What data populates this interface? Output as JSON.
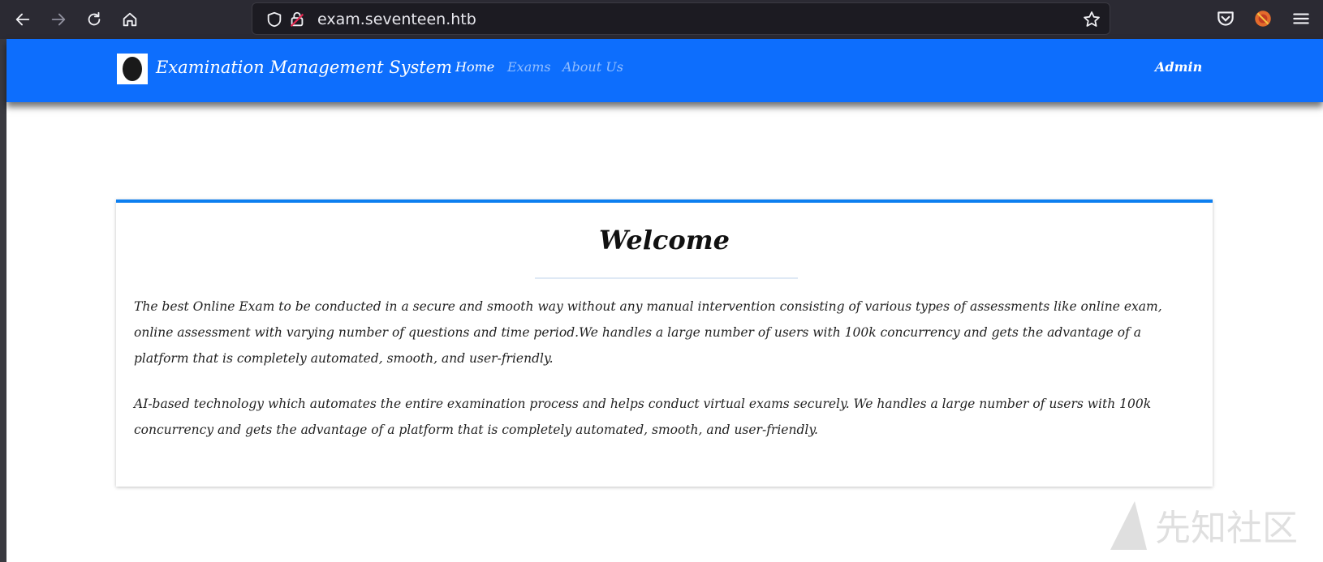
{
  "browser": {
    "url": "exam.seventeen.htb"
  },
  "site": {
    "brand": "Examination Management System",
    "nav": {
      "home": "Home",
      "exams": "Exams",
      "about": "About Us",
      "user": "Admin"
    }
  },
  "card": {
    "title": "Welcome",
    "paragraphs": [
      "The best Online Exam to be conducted in a secure and smooth way without any manual intervention consisting of various types of assessments like online exam, online assessment with varying number of questions and time period.We handles a large number of users with 100k concurrency and gets the advantage of a platform that is completely automated, smooth, and user-friendly.",
      "AI-based technology which automates the entire examination process and helps conduct virtual exams securely. We handles a large number of users with 100k concurrency and gets the advantage of a platform that is completely automated, smooth, and user-friendly."
    ]
  },
  "watermark": "先知社区",
  "icons": {
    "back": "back-arrow-icon",
    "forward": "forward-arrow-icon",
    "reload": "reload-icon",
    "home": "home-icon",
    "shield": "shield-icon",
    "lock": "lock-icon",
    "star": "star-icon",
    "pocket": "pocket-icon",
    "extension": "extension-icon",
    "menu": "menu-icon"
  },
  "colors": {
    "nav_bg": "#0d6efd",
    "card_accent": "#0d7ff0",
    "browser_bg": "#2b2a33"
  }
}
